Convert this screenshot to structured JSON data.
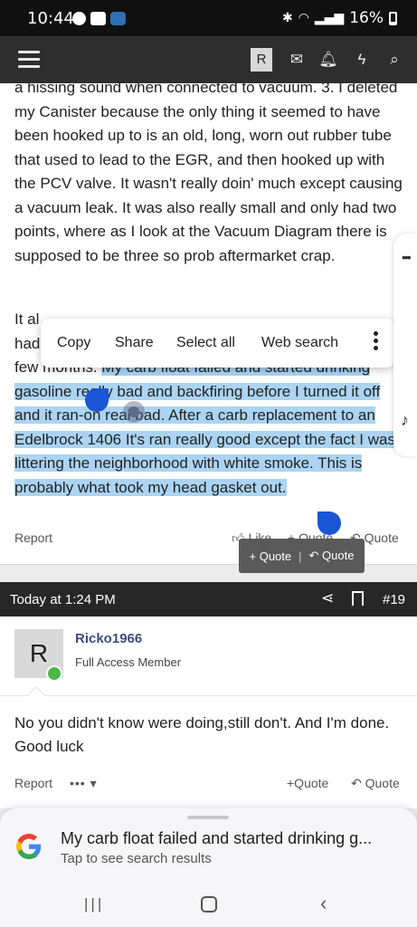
{
  "status_bar": {
    "time": "10:44",
    "battery": "16%"
  },
  "nav": {
    "avatar_letter": "R"
  },
  "post1": {
    "para1": "a hissing sound when connected to vacuum. 3. I deleted my Canister because the only thing it seemed to have been hooked up to is an old, long, worn out rubber tube that used to lead to the EGR, and then hooked up with the PCV valve. It wasn't really doin' much except causing a vacuum leak. It was also really small and only had two points, where as I look at the Vacuum Diagram there is supposed to be three so prob aftermarket crap.",
    "para2_start": "It al",
    "para2_line2": "had",
    "para2_line3": "few months.",
    "selected_text": "My carb float failed and started drinking gasoline really bad and backfiring before I turned it off and it ran-on real bad. After a carb replacement to an Edelbrock 1406 It's ran really good except the fact I was littering the neighborhood with white smoke. This is probably what took my head gasket out.",
    "report": "Report",
    "like": "Like",
    "quote_plus": "Quote",
    "quote": "Quote"
  },
  "context_menu": {
    "copy": "Copy",
    "share": "Share",
    "select_all": "Select all",
    "web_search": "Web search"
  },
  "mini_popup": {
    "add_quote": "+ Quote",
    "separator": "|",
    "quote": "Quote"
  },
  "post2": {
    "date": "Today at 1:24 PM",
    "number": "#19",
    "avatar_letter": "R",
    "username": "Ricko1966",
    "role": "Full Access Member",
    "message": "No you didn't know were doing,still don't. And I'm done. Good luck",
    "report": "Report",
    "more": "••• ▾",
    "quote_plus": "+Quote",
    "quote": "Quote"
  },
  "google_sheet": {
    "title": "My carb float failed and started drinking g...",
    "subtitle": "Tap to see search results"
  },
  "colors": {
    "selection": "#abd4f2",
    "handle": "#1a56d6",
    "username": "#3a4e7e"
  }
}
